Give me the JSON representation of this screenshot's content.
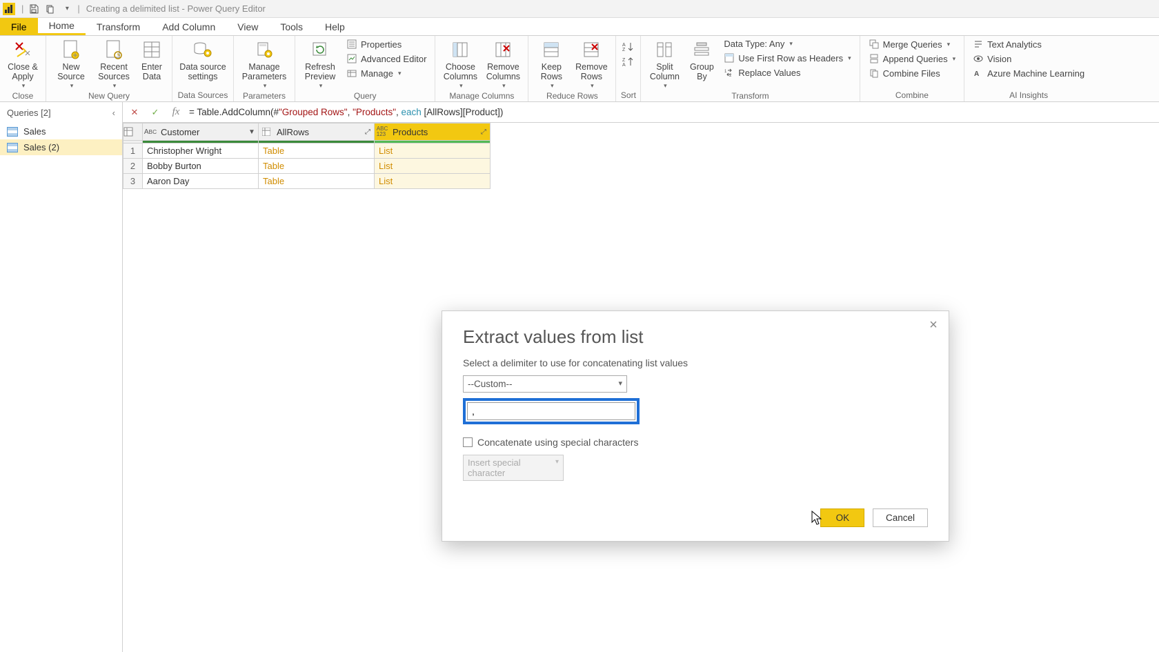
{
  "titlebar": {
    "title": "Creating a delimited list - Power Query Editor"
  },
  "ribbon_tabs": {
    "file": "File",
    "home": "Home",
    "transform": "Transform",
    "add_column": "Add Column",
    "view": "View",
    "tools": "Tools",
    "help": "Help"
  },
  "ribbon": {
    "close": {
      "close_apply": "Close & Apply",
      "group": "Close"
    },
    "new_query": {
      "new_source": "New Source",
      "recent_sources": "Recent Sources",
      "enter_data": "Enter Data",
      "group": "New Query"
    },
    "data_sources": {
      "data_source_settings": "Data source settings",
      "group": "Data Sources"
    },
    "parameters": {
      "manage_parameters": "Manage Parameters",
      "group": "Parameters"
    },
    "query": {
      "refresh_preview": "Refresh Preview",
      "properties": "Properties",
      "advanced_editor": "Advanced Editor",
      "manage": "Manage",
      "group": "Query"
    },
    "manage_columns": {
      "choose_columns": "Choose Columns",
      "remove_columns": "Remove Columns",
      "group": "Manage Columns"
    },
    "reduce_rows": {
      "keep_rows": "Keep Rows",
      "remove_rows": "Remove Rows",
      "group": "Reduce Rows"
    },
    "sort": {
      "group": "Sort"
    },
    "transform": {
      "split_column": "Split Column",
      "group_by": "Group By",
      "data_type": "Data Type: Any",
      "use_first_row": "Use First Row as Headers",
      "replace_values": "Replace Values",
      "group": "Transform"
    },
    "combine": {
      "merge_queries": "Merge Queries",
      "append_queries": "Append Queries",
      "combine_files": "Combine Files",
      "group": "Combine"
    },
    "ai": {
      "text_analytics": "Text Analytics",
      "vision": "Vision",
      "azure_ml": "Azure Machine Learning",
      "group": "AI Insights"
    }
  },
  "queries": {
    "header": "Queries [2]",
    "items": [
      {
        "name": "Sales"
      },
      {
        "name": "Sales (2)"
      }
    ]
  },
  "formula": {
    "pre": "= Table.AddColumn(#",
    "s1": "\"Grouped Rows\"",
    "mid1": ", ",
    "s2": "\"Products\"",
    "mid2": ", ",
    "kw": "each",
    "post": " [AllRows][Product])"
  },
  "grid": {
    "columns": [
      {
        "name": "Customer",
        "type": "ABC"
      },
      {
        "name": "AllRows",
        "type": "table"
      },
      {
        "name": "Products",
        "type": "ABC123"
      }
    ],
    "rows": [
      {
        "n": "1",
        "customer": "Christopher Wright",
        "allrows": "Table",
        "products": "List"
      },
      {
        "n": "2",
        "customer": "Bobby Burton",
        "allrows": "Table",
        "products": "List"
      },
      {
        "n": "3",
        "customer": "Aaron Day",
        "allrows": "Table",
        "products": "List"
      }
    ]
  },
  "dialog": {
    "title": "Extract values from list",
    "desc": "Select a delimiter to use for concatenating list values",
    "delimiter_select": "--Custom--",
    "custom_value": ", ",
    "checkbox_label": "Concatenate using special characters",
    "special_select": "Insert special character",
    "ok": "OK",
    "cancel": "Cancel"
  }
}
